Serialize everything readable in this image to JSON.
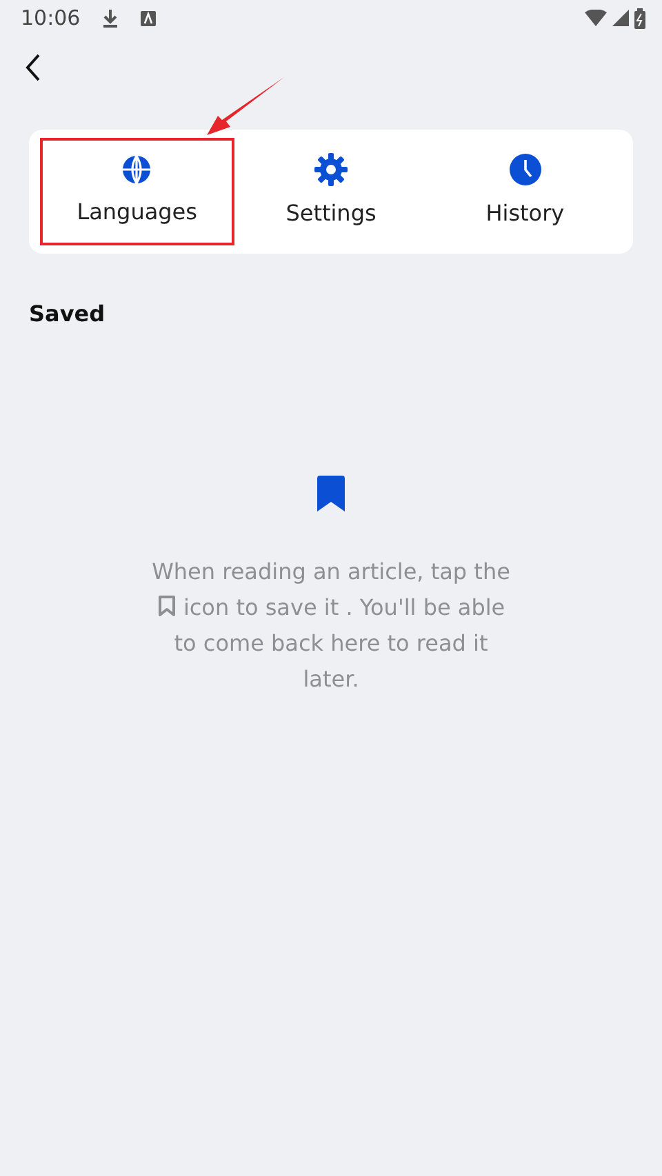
{
  "status_bar": {
    "time": "10:06"
  },
  "tabs": [
    {
      "kind": "globe",
      "label": "Languages",
      "highlighted": true
    },
    {
      "kind": "gear",
      "label": "Settings",
      "highlighted": false
    },
    {
      "kind": "clock",
      "label": "History",
      "highlighted": false
    }
  ],
  "section_title": "Saved",
  "empty_state": {
    "text_before": "When reading an article, tap the",
    "text_after": "icon to save it . You'll be able to come back here to read it later."
  }
}
